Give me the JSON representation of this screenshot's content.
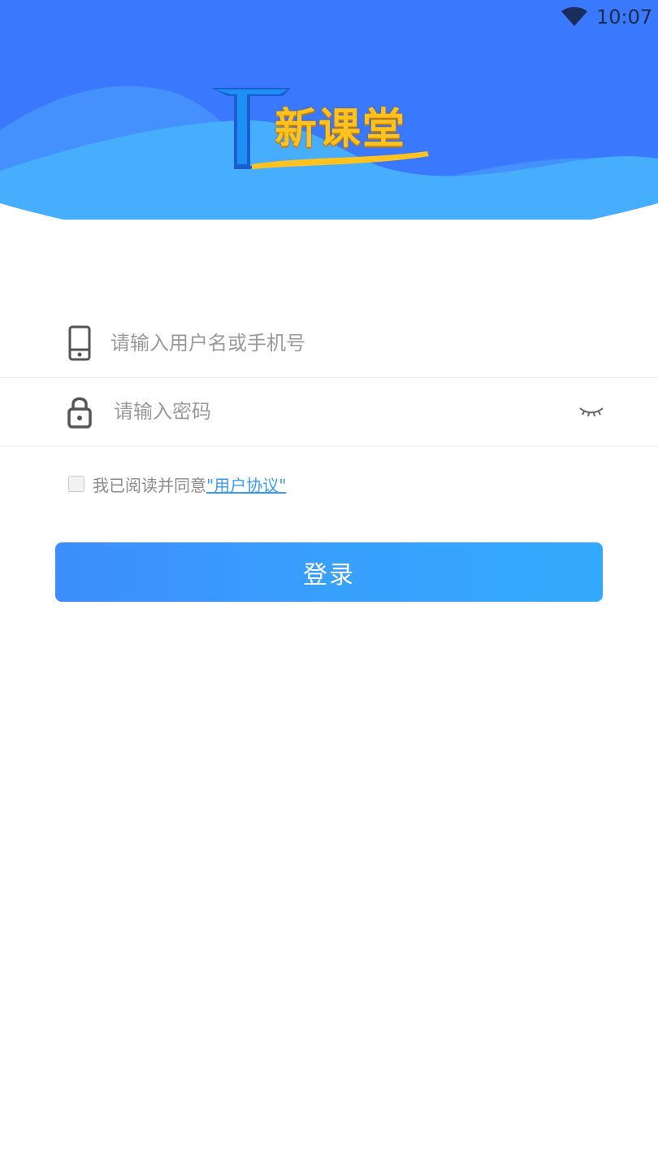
{
  "status_bar": {
    "time": "10:07",
    "wifi_icon": "wifi-icon"
  },
  "logo": {
    "text": "新课堂",
    "icon": "logo-t-icon"
  },
  "colors": {
    "header_blue": "#3a78fd",
    "wave_light": "#46aefd",
    "button": "#38a0fd",
    "link": "#3a9bf0"
  },
  "form": {
    "username": {
      "placeholder": "请输入用户名或手机号",
      "value": "",
      "icon": "phone-icon"
    },
    "password": {
      "placeholder": "请输入密码",
      "value": "",
      "icon": "lock-icon",
      "toggle_icon": "eye-closed-icon"
    },
    "agreement": {
      "checked": false,
      "text": "我已阅读并同意",
      "link_text": "\"用户协议\""
    },
    "login_label": "登录"
  }
}
